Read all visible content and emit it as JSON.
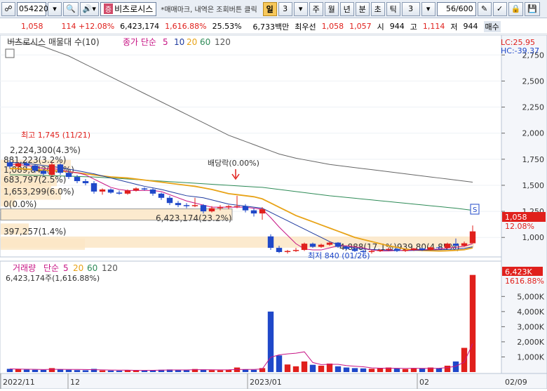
{
  "toolbar": {
    "code": "054220",
    "stock_name": "비츠로시스",
    "name_tag": "증",
    "notice": "*매매마크, 내역은 조회버튼 클릭",
    "period_label": "일",
    "period_value": "3",
    "units": [
      "주",
      "월",
      "년",
      "분",
      "초",
      "틱"
    ],
    "tick_value": "3",
    "count": "56/600"
  },
  "quote": {
    "price": "1,058",
    "change": "114 +12.08%",
    "volume": "6,423,174",
    "volume_pct": "1,616.88%",
    "turnover": "25.53%",
    "amount": "6,733백만",
    "best_label": "최우선",
    "ask": "1,058",
    "bid": "1,057",
    "open_label": "시",
    "open": "944",
    "high_label": "고",
    "high": "1,114",
    "low_label": "저",
    "low": "944",
    "extra": "매수"
  },
  "price_panel": {
    "legend_title": "비츠로시스 매물대 수(10)",
    "ma_label": "종가 단순",
    "ma_periods": [
      "5",
      "10",
      "20",
      "60",
      "120"
    ],
    "lc": "LC:25.95",
    "hc": "HC:-39.37",
    "y_ticks": [
      "2,750",
      "2,500",
      "2,250",
      "2,000",
      "1,750",
      "1,500",
      "1,250",
      "1,000"
    ],
    "current_price": "1,058",
    "current_pct": "12.08%",
    "high_note": "최고 1,745 (11/21)",
    "low_note": "최저 840 (01/26)",
    "dividend_note": "배당락(0.00%)",
    "profile_labels": [
      "2,224,300(4.3%)",
      "881,223(3.2%)",
      "1,089,842(3.9%)",
      "683,797(2.5%)",
      "1,653,299(6.0%)",
      "0(0.0%)",
      "6,423,174(23.2%)",
      "397,257(1.4%)",
      "4,888(17.1%)",
      "939,80(4.85%)"
    ]
  },
  "volume_panel": {
    "legend_title": "거래량",
    "ma_label": "단순",
    "ma_periods": [
      "5",
      "20",
      "60",
      "120"
    ],
    "summary": "6,423,174주(1,616.88%)",
    "current_volume": "6,423K",
    "current_pct": "1616.88%",
    "y_ticks": [
      "5,000K",
      "4,000K",
      "3,000K",
      "2,000K",
      "1,000K"
    ]
  },
  "x_axis": {
    "labels": [
      "2022/11",
      "12",
      "2023/01",
      "02",
      "02/09"
    ]
  },
  "colors": {
    "up": "#e0201c",
    "down": "#1f48c9",
    "ma5": "#c71585",
    "ma10": "#1f3b9f",
    "ma20": "#e8a317",
    "ma60": "#2e8b57",
    "ma120": "#666666",
    "profile": "#fbe6c6"
  },
  "chart_data": {
    "type": "candlestick",
    "candles": [
      {
        "o": 1720,
        "h": 1745,
        "l": 1660,
        "c": 1680
      },
      {
        "o": 1680,
        "h": 1720,
        "l": 1650,
        "c": 1710
      },
      {
        "o": 1710,
        "h": 1730,
        "l": 1670,
        "c": 1690
      },
      {
        "o": 1690,
        "h": 1700,
        "l": 1620,
        "c": 1640
      },
      {
        "o": 1640,
        "h": 1660,
        "l": 1590,
        "c": 1610
      },
      {
        "o": 1600,
        "h": 1720,
        "l": 1590,
        "c": 1700
      },
      {
        "o": 1700,
        "h": 1710,
        "l": 1600,
        "c": 1620
      },
      {
        "o": 1620,
        "h": 1640,
        "l": 1560,
        "c": 1580
      },
      {
        "o": 1580,
        "h": 1600,
        "l": 1520,
        "c": 1540
      },
      {
        "o": 1540,
        "h": 1560,
        "l": 1500,
        "c": 1520
      },
      {
        "o": 1520,
        "h": 1540,
        "l": 1420,
        "c": 1440
      },
      {
        "o": 1440,
        "h": 1470,
        "l": 1410,
        "c": 1460
      },
      {
        "o": 1460,
        "h": 1470,
        "l": 1420,
        "c": 1430
      },
      {
        "o": 1430,
        "h": 1450,
        "l": 1410,
        "c": 1420
      },
      {
        "o": 1420,
        "h": 1460,
        "l": 1410,
        "c": 1450
      },
      {
        "o": 1450,
        "h": 1480,
        "l": 1440,
        "c": 1470
      },
      {
        "o": 1470,
        "h": 1480,
        "l": 1450,
        "c": 1460
      },
      {
        "o": 1460,
        "h": 1470,
        "l": 1400,
        "c": 1420
      },
      {
        "o": 1420,
        "h": 1430,
        "l": 1360,
        "c": 1380
      },
      {
        "o": 1380,
        "h": 1400,
        "l": 1310,
        "c": 1330
      },
      {
        "o": 1330,
        "h": 1350,
        "l": 1290,
        "c": 1310
      },
      {
        "o": 1310,
        "h": 1330,
        "l": 1280,
        "c": 1300
      },
      {
        "o": 1300,
        "h": 1380,
        "l": 1290,
        "c": 1310
      },
      {
        "o": 1310,
        "h": 1320,
        "l": 1230,
        "c": 1250
      },
      {
        "o": 1250,
        "h": 1300,
        "l": 1240,
        "c": 1280
      },
      {
        "o": 1280,
        "h": 1310,
        "l": 1260,
        "c": 1290
      },
      {
        "o": 1290,
        "h": 1310,
        "l": 1270,
        "c": 1300
      },
      {
        "o": 1300,
        "h": 1400,
        "l": 1280,
        "c": 1300
      },
      {
        "o": 1300,
        "h": 1320,
        "l": 1240,
        "c": 1260
      },
      {
        "o": 1260,
        "h": 1280,
        "l": 1200,
        "c": 1230
      },
      {
        "o": 1230,
        "h": 1290,
        "l": 1170,
        "c": 1270
      },
      {
        "o": 1010,
        "h": 1030,
        "l": 880,
        "c": 900
      },
      {
        "o": 900,
        "h": 920,
        "l": 850,
        "c": 860
      },
      {
        "o": 860,
        "h": 880,
        "l": 845,
        "c": 870
      },
      {
        "o": 870,
        "h": 900,
        "l": 860,
        "c": 880
      },
      {
        "o": 880,
        "h": 950,
        "l": 870,
        "c": 940
      },
      {
        "o": 940,
        "h": 950,
        "l": 900,
        "c": 910
      },
      {
        "o": 910,
        "h": 940,
        "l": 900,
        "c": 930
      },
      {
        "o": 930,
        "h": 960,
        "l": 920,
        "c": 950
      },
      {
        "o": 950,
        "h": 955,
        "l": 900,
        "c": 910
      },
      {
        "o": 910,
        "h": 920,
        "l": 880,
        "c": 890
      },
      {
        "o": 890,
        "h": 900,
        "l": 860,
        "c": 870
      },
      {
        "o": 870,
        "h": 880,
        "l": 850,
        "c": 860
      },
      {
        "o": 860,
        "h": 880,
        "l": 845,
        "c": 870
      },
      {
        "o": 870,
        "h": 890,
        "l": 860,
        "c": 880
      },
      {
        "o": 880,
        "h": 900,
        "l": 870,
        "c": 890
      },
      {
        "o": 890,
        "h": 900,
        "l": 860,
        "c": 870
      },
      {
        "o": 870,
        "h": 890,
        "l": 860,
        "c": 880
      },
      {
        "o": 880,
        "h": 900,
        "l": 870,
        "c": 895
      },
      {
        "o": 895,
        "h": 900,
        "l": 870,
        "c": 880
      },
      {
        "o": 880,
        "h": 910,
        "l": 875,
        "c": 905
      },
      {
        "o": 905,
        "h": 915,
        "l": 890,
        "c": 900
      },
      {
        "o": 900,
        "h": 950,
        "l": 895,
        "c": 940
      },
      {
        "o": 940,
        "h": 990,
        "l": 900,
        "c": 920
      },
      {
        "o": 920,
        "h": 960,
        "l": 910,
        "c": 944
      },
      {
        "o": 944,
        "h": 1114,
        "l": 944,
        "c": 1058
      }
    ],
    "volumes": [
      210,
      190,
      160,
      150,
      140,
      260,
      180,
      150,
      130,
      120,
      210,
      110,
      100,
      90,
      120,
      140,
      110,
      130,
      150,
      170,
      130,
      120,
      200,
      160,
      130,
      120,
      140,
      300,
      170,
      150,
      260,
      4000,
      1100,
      500,
      380,
      700,
      480,
      420,
      560,
      380,
      300,
      260,
      240,
      220,
      250,
      300,
      230,
      200,
      260,
      240,
      300,
      260,
      420,
      700,
      1600,
      6423
    ],
    "ma5": [
      1700,
      1700,
      1690,
      1680,
      1660,
      1660,
      1650,
      1630,
      1620,
      1600,
      1560,
      1520,
      1480,
      1460,
      1450,
      1450,
      1450,
      1450,
      1440,
      1410,
      1380,
      1350,
      1330,
      1310,
      1290,
      1290,
      1290,
      1290,
      1290,
      1280,
      1270,
      1190,
      1100,
      1020,
      940,
      890,
      880,
      880,
      900,
      920,
      920,
      910,
      900,
      880,
      870,
      870,
      875,
      875,
      880,
      882,
      885,
      888,
      898,
      905,
      915,
      940
    ],
    "ma10": [
      1720,
      1715,
      1710,
      1700,
      1690,
      1680,
      1670,
      1655,
      1640,
      1625,
      1610,
      1590,
      1570,
      1550,
      1530,
      1510,
      1490,
      1475,
      1460,
      1440,
      1420,
      1400,
      1390,
      1380,
      1360,
      1340,
      1320,
      1310,
      1300,
      1290,
      1280,
      1240,
      1200,
      1160,
      1120,
      1080,
      1040,
      1000,
      960,
      930,
      910,
      900,
      890,
      885,
      880,
      878,
      876,
      874,
      875,
      878,
      880,
      882,
      884,
      888,
      895,
      910
    ],
    "ma20": [
      1660,
      1660,
      1655,
      1650,
      1645,
      1640,
      1635,
      1630,
      1620,
      1610,
      1600,
      1590,
      1580,
      1575,
      1570,
      1560,
      1550,
      1540,
      1530,
      1520,
      1510,
      1500,
      1490,
      1475,
      1460,
      1440,
      1420,
      1410,
      1400,
      1390,
      1370,
      1330,
      1290,
      1250,
      1210,
      1180,
      1150,
      1120,
      1090,
      1060,
      1030,
      1000,
      980,
      960,
      940,
      920,
      905,
      890,
      880,
      875,
      872,
      870,
      872,
      876,
      882,
      900
    ],
    "ma60": [
      1600,
      1600,
      1598,
      1596,
      1594,
      1592,
      1590,
      1588,
      1585,
      1582,
      1580,
      1575,
      1570,
      1565,
      1560,
      1555,
      1550,
      1545,
      1540,
      1535,
      1530,
      1525,
      1520,
      1515,
      1510,
      1505,
      1500,
      1495,
      1490,
      1485,
      1480,
      1470,
      1460,
      1450,
      1440,
      1430,
      1420,
      1410,
      1400,
      1392,
      1384,
      1376,
      1368,
      1360,
      1352,
      1344,
      1336,
      1328,
      1320,
      1312,
      1304,
      1296,
      1288,
      1280,
      1270,
      1260
    ],
    "ma120": [
      2880,
      2870,
      2860,
      2850,
      2830,
      2800,
      2770,
      2740,
      2700,
      2660,
      2620,
      2580,
      2540,
      2500,
      2460,
      2420,
      2380,
      2340,
      2300,
      2260,
      2220,
      2180,
      2140,
      2100,
      2060,
      2020,
      1980,
      1950,
      1920,
      1890,
      1860,
      1830,
      1800,
      1780,
      1760,
      1745,
      1730,
      1715,
      1700,
      1690,
      1680,
      1670,
      1660,
      1650,
      1640,
      1630,
      1620,
      1610,
      1600,
      1590,
      1580,
      1570,
      1560,
      1550,
      1540,
      1530
    ],
    "y_range": [
      840,
      2900
    ],
    "volume_range": [
      0,
      6500
    ]
  }
}
